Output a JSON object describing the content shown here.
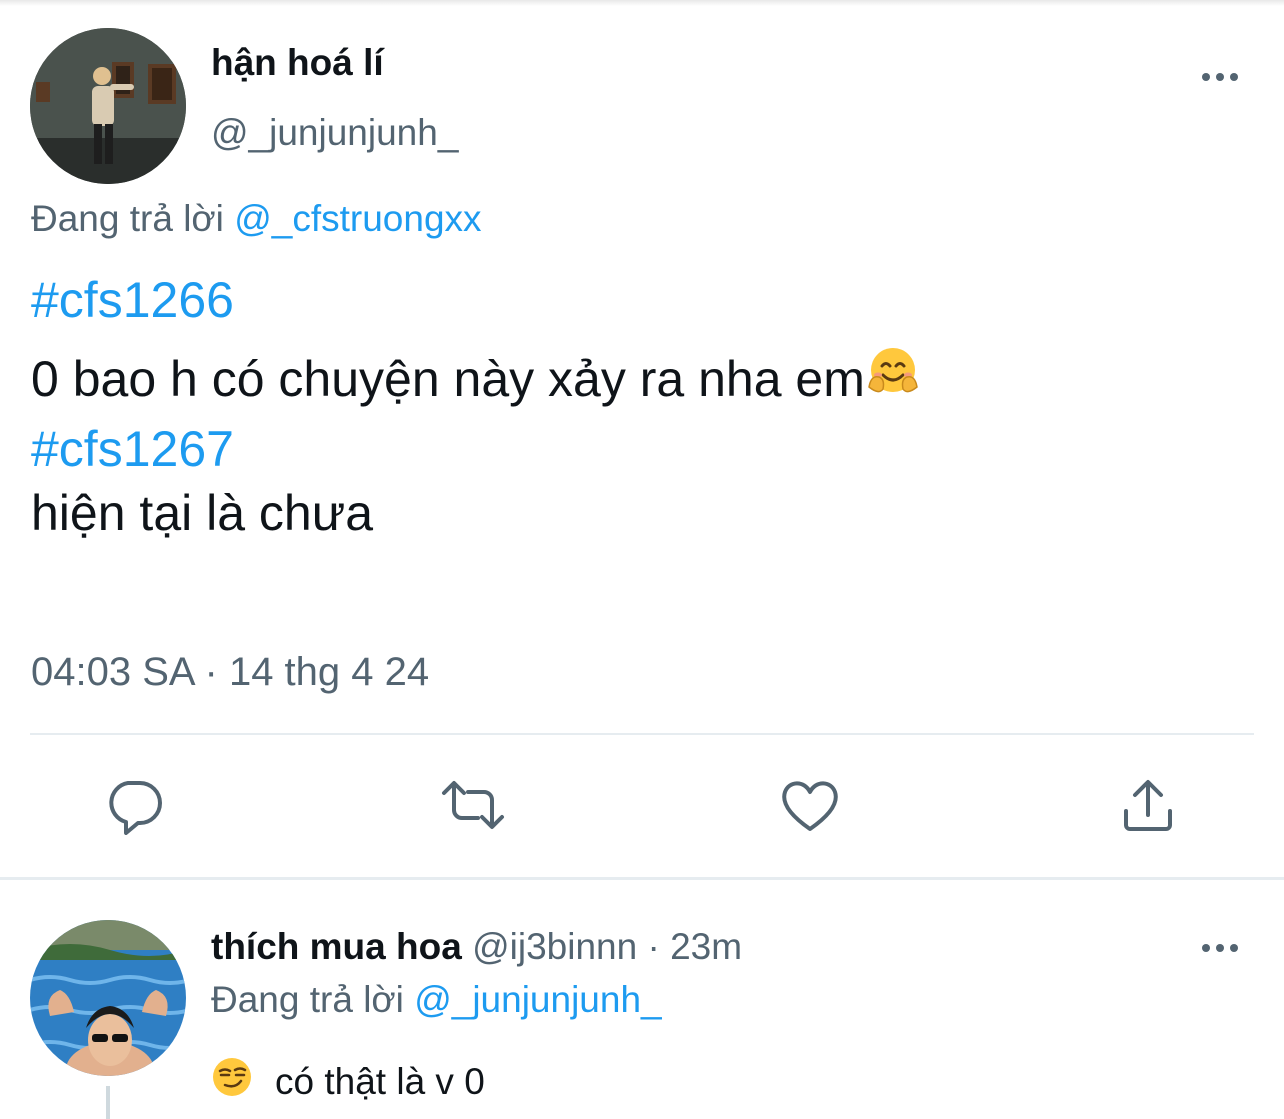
{
  "tweet": {
    "display_name": "hận hoá lí",
    "handle": "@_junjunjunh_",
    "replying_prefix": "Đang trả lời",
    "replying_to": "@_cfstruongxx",
    "hashtag_1": "#cfs1266",
    "text_1": "0 bao h có chuyện này xảy ra nha em",
    "text_1_emoji": "smiling-face-with-open-hands",
    "hashtag_2": "#cfs1267",
    "text_2": "hiện tại là chưa",
    "time": "04:03 SA",
    "separator": "·",
    "date": "14 thg 4 24"
  },
  "actions": [
    "reply-icon",
    "retweet-icon",
    "like-icon",
    "share-icon"
  ],
  "reply": {
    "display_name": "thích mua hoa",
    "handle": "@ij3binnn",
    "separator": "·",
    "time_ago": "23m",
    "replying_prefix": "Đang trả lời",
    "replying_to": "@_junjunjunh_",
    "emoji": "smirking-face",
    "text": "có thật là v 0"
  },
  "colors": {
    "link": "#1d9bf0",
    "text": "#0f1419",
    "secondary": "#536471",
    "divider": "#e6ecf0"
  }
}
